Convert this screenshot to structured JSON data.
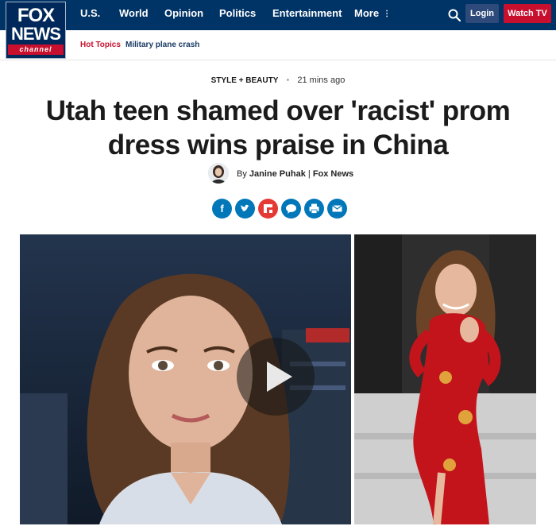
{
  "brand": {
    "line1": "FOX",
    "line2": "NEWS",
    "strip": "channel"
  },
  "nav": {
    "items": [
      "U.S.",
      "World",
      "Opinion",
      "Politics",
      "Entertainment",
      "More"
    ],
    "login_label": "Login",
    "watch_label": "Watch TV"
  },
  "subnav": {
    "hot_topics_label": "Hot Topics",
    "topic": "Military plane crash"
  },
  "article": {
    "category": "STYLE + BEAUTY",
    "time": "21 mins ago",
    "headline_line1": "Utah teen shamed over 'racist' prom",
    "headline_line2": "dress wins praise in China",
    "byline_prefix": "By",
    "author": "Janine Puhak",
    "outlet": "Fox News"
  },
  "share": {
    "icons": [
      "facebook-icon",
      "twitter-icon",
      "flipboard-icon",
      "comment-icon",
      "print-icon",
      "email-icon"
    ]
  },
  "colors": {
    "topbar": "#003366",
    "accent_red": "#c8102e",
    "share_blue": "#0077b8",
    "flipboard_red": "#e53935"
  }
}
